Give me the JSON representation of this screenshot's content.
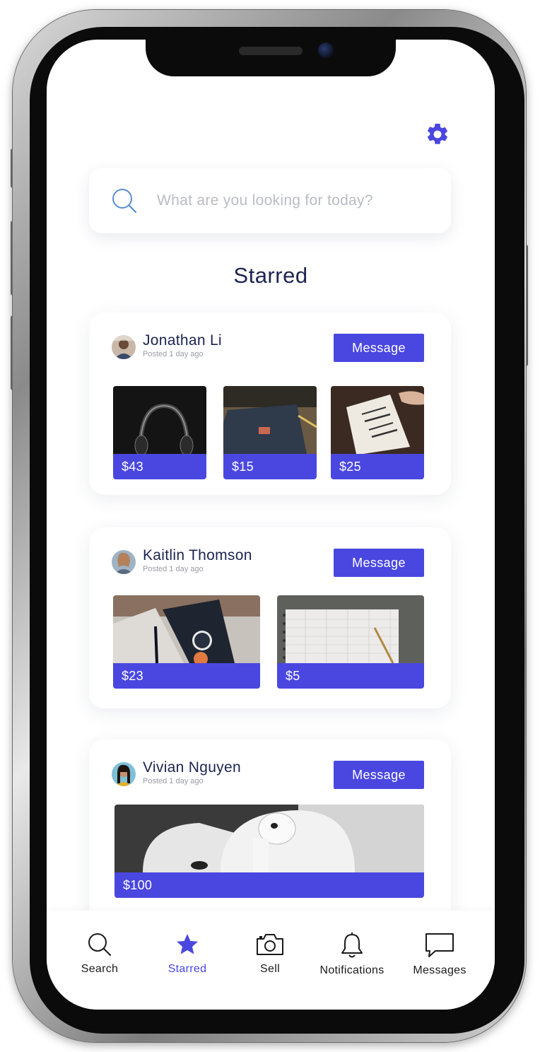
{
  "colors": {
    "accent": "#4a47e0",
    "title": "#1c2450",
    "muted": "#9a9ca5",
    "placeholder": "#b9bcc4"
  },
  "search": {
    "placeholder": "What are you looking for today?",
    "icon": "search-icon"
  },
  "settings": {
    "icon": "gear-icon"
  },
  "section": {
    "title": "Starred"
  },
  "listings": [
    {
      "seller": "Jonathan Li",
      "posted": "Posted 1 day ago",
      "message_label": "Message",
      "items": [
        {
          "name": "headphones",
          "price": "$43"
        },
        {
          "name": "notebook",
          "price": "$15"
        },
        {
          "name": "book",
          "price": "$25"
        }
      ]
    },
    {
      "seller": "Kaitlin Thomson",
      "posted": "Posted 1 day ago",
      "message_label": "Message",
      "items": [
        {
          "name": "journal",
          "price": "$23"
        },
        {
          "name": "grid-notebook",
          "price": "$5"
        }
      ]
    },
    {
      "seller": "Vivian Nguyen",
      "posted": "Posted 1 day ago",
      "message_label": "Message",
      "items": [
        {
          "name": "airpods",
          "price": "$100"
        }
      ]
    }
  ],
  "tabs": [
    {
      "label": "Search",
      "icon": "search-icon",
      "active": false
    },
    {
      "label": "Starred",
      "icon": "star-icon",
      "active": true
    },
    {
      "label": "Sell",
      "icon": "camera-icon",
      "active": false
    },
    {
      "label": "Notifications",
      "icon": "bell-icon",
      "active": false
    },
    {
      "label": "Messages",
      "icon": "chat-icon",
      "active": false
    }
  ]
}
